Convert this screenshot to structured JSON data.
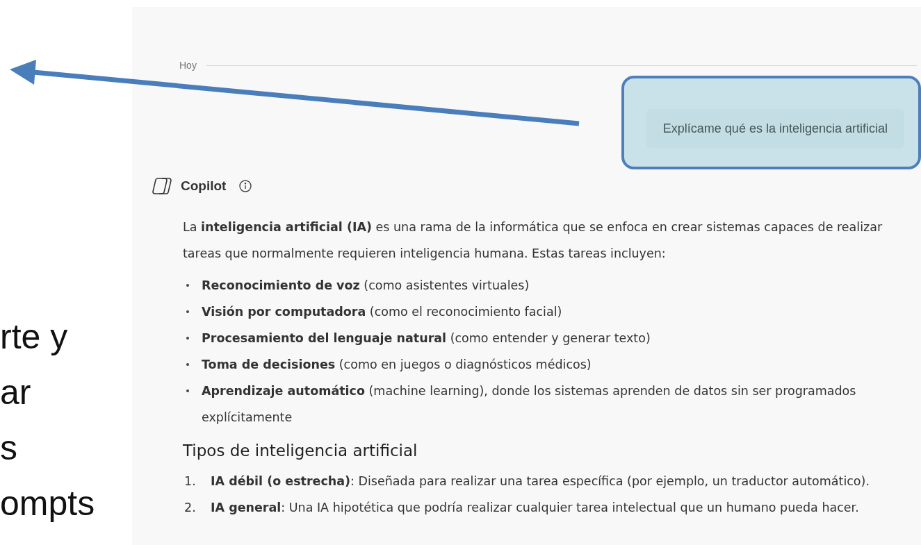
{
  "slide_text": [
    "rte y",
    "ar",
    "s",
    "ompts"
  ],
  "chat": {
    "date_divider": "Hoy",
    "user_message": "Explícame qué es la inteligencia artificial",
    "assistant": {
      "name": "Copilot",
      "intro": "La **inteligencia artificial (IA)** es una rama de la informática que se enfoca en crear sistemas capaces de realizar tareas que normalmente requieren inteligencia humana. Estas tareas incluyen:",
      "bullets": [
        "**Reconocimiento de voz** (como asistentes virtuales)",
        "**Visión por computadora** (como el reconocimiento facial)",
        "**Procesamiento del lenguaje natural** (como entender y generar texto)",
        "**Toma de decisiones** (como en juegos o diagnósticos médicos)",
        "**Aprendizaje automático** (machine learning), donde los sistemas aprenden de datos sin ser programados explícitamente"
      ],
      "heading": "Tipos de inteligencia artificial",
      "numbered": [
        {
          "number": "1.",
          "text": "**IA débil (o estrecha)**: Diseñada para realizar una tarea específica (por ejemplo, un traductor automático)."
        },
        {
          "number": "2.",
          "text": "**IA general**: Una IA hipotética que podría realizar cualquier tarea intelectual que un humano pueda hacer."
        }
      ]
    }
  }
}
